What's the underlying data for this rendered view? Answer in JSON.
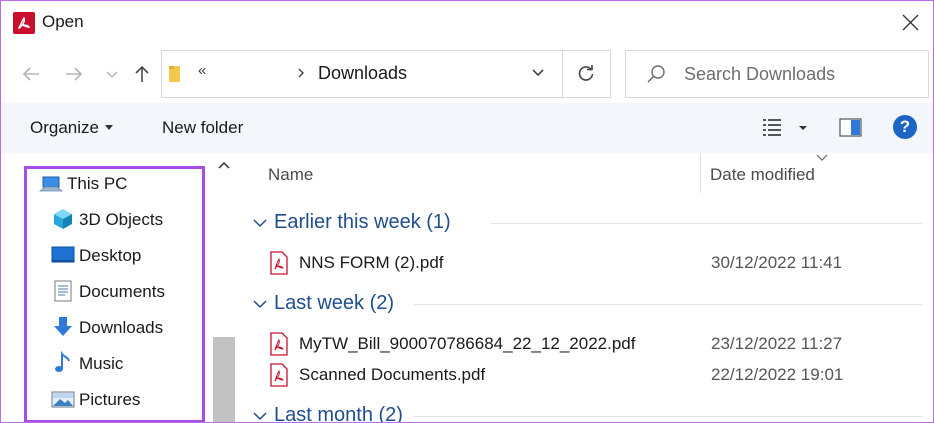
{
  "window": {
    "title": "Open",
    "app_icon": "acrobat-icon",
    "accent_color": "#c8102e",
    "highlight_color": "#a64ee8"
  },
  "navigation": {
    "back_icon": "arrow-left-icon",
    "forward_icon": "arrow-right-icon",
    "recent_icon": "chevron-down-icon",
    "up_icon": "arrow-up-icon"
  },
  "address_bar": {
    "overflow_label": "«",
    "current": "Downloads"
  },
  "search": {
    "placeholder": "Search Downloads"
  },
  "toolbar": {
    "organize_label": "Organize",
    "new_folder_label": "New folder",
    "help_label": "?"
  },
  "nav_pane": {
    "items": [
      {
        "label": "This PC",
        "icon": "this-pc-icon"
      },
      {
        "label": "3D Objects",
        "icon": "3d-objects-icon"
      },
      {
        "label": "Desktop",
        "icon": "desktop-icon"
      },
      {
        "label": "Documents",
        "icon": "documents-icon"
      },
      {
        "label": "Downloads",
        "icon": "downloads-icon"
      },
      {
        "label": "Music",
        "icon": "music-icon"
      },
      {
        "label": "Pictures",
        "icon": "pictures-icon"
      }
    ]
  },
  "file_list": {
    "columns": {
      "name": "Name",
      "date": "Date modified"
    },
    "groups": [
      {
        "label": "Earlier this week (1)",
        "files": [
          {
            "name": "NNS FORM (2).pdf",
            "date": "30/12/2022 11:41",
            "icon": "pdf-icon"
          }
        ]
      },
      {
        "label": "Last week (2)",
        "files": [
          {
            "name": "MyTW_Bill_900070786684_22_12_2022.pdf",
            "date": "23/12/2022 11:27",
            "icon": "pdf-icon"
          },
          {
            "name": "Scanned Documents.pdf",
            "date": "22/12/2022 19:01",
            "icon": "pdf-icon"
          }
        ]
      },
      {
        "label": "Last month (2)",
        "files": []
      }
    ]
  }
}
